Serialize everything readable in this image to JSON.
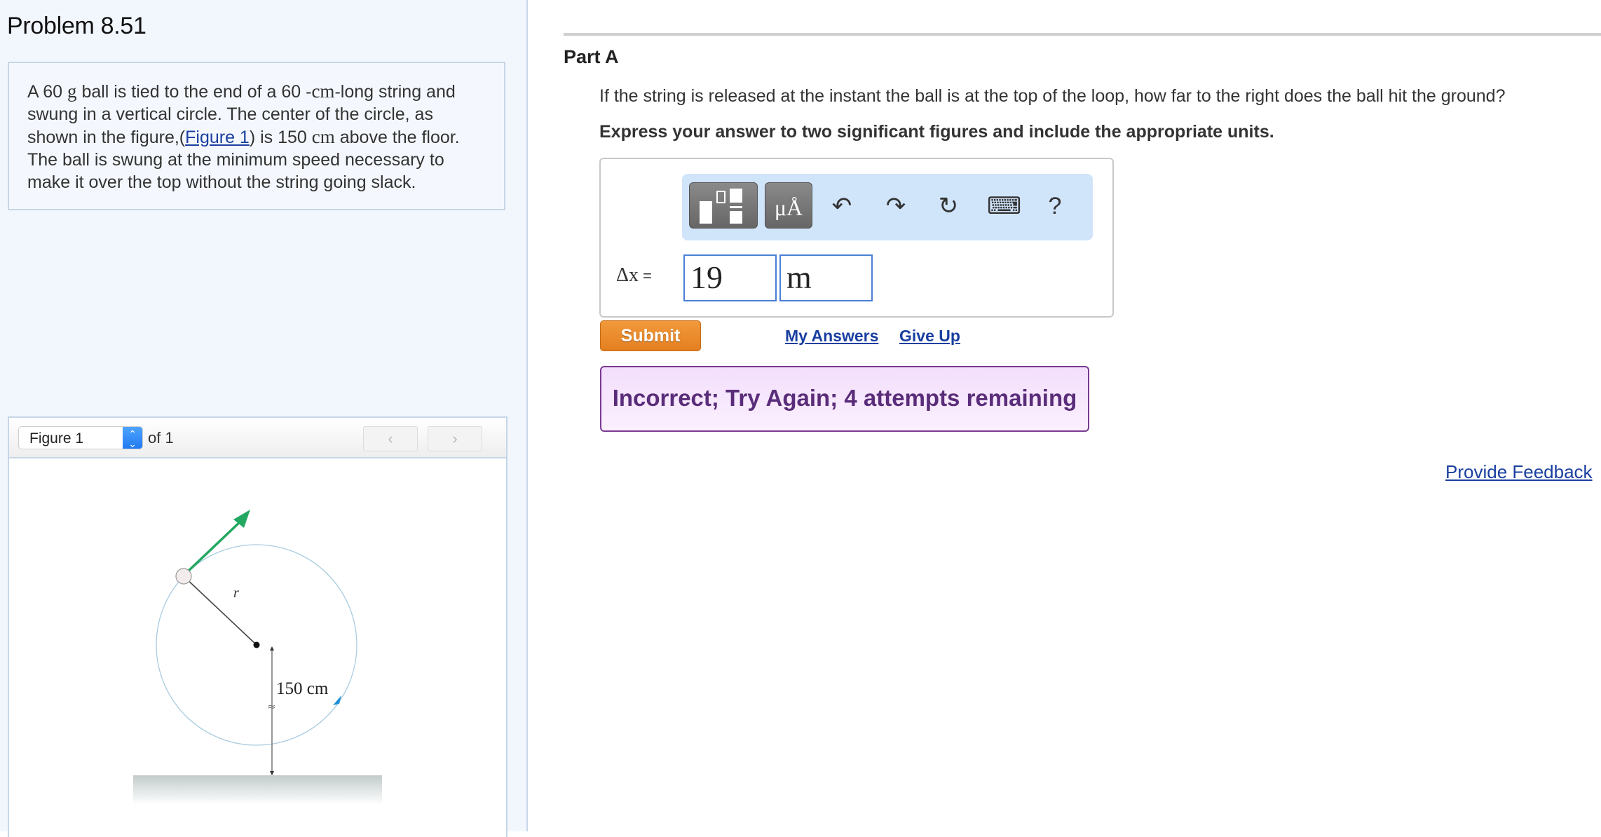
{
  "problem": {
    "title": "Problem 8.51",
    "text_parts": {
      "p1": "A 60 ",
      "unit_g": "g",
      "p2": " ball is tied to the end of a 60 -",
      "unit_cm1": "cm",
      "p3": "-long string and swung in a vertical circle. The center of the circle, as shown in the figure,(",
      "figure_link": "Figure 1",
      "p4": ") is 150 ",
      "unit_cm2": "cm",
      "p5": " above the floor. The ball is swung at the minimum speed necessary to make it over the top without the string going slack."
    }
  },
  "figure_viewer": {
    "selected": "Figure 1",
    "of_label": "of 1",
    "prev_icon": "chevron-left-icon",
    "next_icon": "chevron-right-icon",
    "prev_glyph": "‹",
    "next_glyph": "›"
  },
  "figure": {
    "radius_label": "r",
    "height_label": "150 cm",
    "break_symbol": "≈",
    "colors": {
      "velocity_arrow": "#22a860",
      "circle": "#a9cce0",
      "direction_arrow": "#1f8fd6"
    }
  },
  "part": {
    "title": "Part A",
    "question": "If the string is released at the instant the ball is at the top of the loop, how far to the right does the ball hit the ground?",
    "instruction": "Express your answer to two significant figures and include the appropriate units."
  },
  "toolbar": {
    "templates_icon": "templates-icon",
    "symbols_label": "μÅ",
    "undo_glyph": "↶",
    "redo_glyph": "↷",
    "reset_glyph": "↻",
    "keyboard_glyph": "⌨",
    "help_label": "?"
  },
  "answer": {
    "label_var": "Δx",
    "label_eq": "=",
    "value": "19",
    "unit": "m"
  },
  "actions": {
    "submit": "Submit",
    "my_answers": "My Answers",
    "give_up": "Give Up"
  },
  "feedback": {
    "message": "Incorrect; Try Again; 4 attempts remaining",
    "attempts_remaining": 4
  },
  "footer": {
    "provide_feedback": "Provide Feedback"
  },
  "colors": {
    "submit": "#e8892b",
    "link": "#1a3fa0",
    "feedback_border": "#7a3a92",
    "feedback_text": "#5a2d7a",
    "toolbar_bg": "#d0e4fa",
    "left_panel_bg": "#f2f7fe",
    "input_border": "#4a7fd6"
  }
}
